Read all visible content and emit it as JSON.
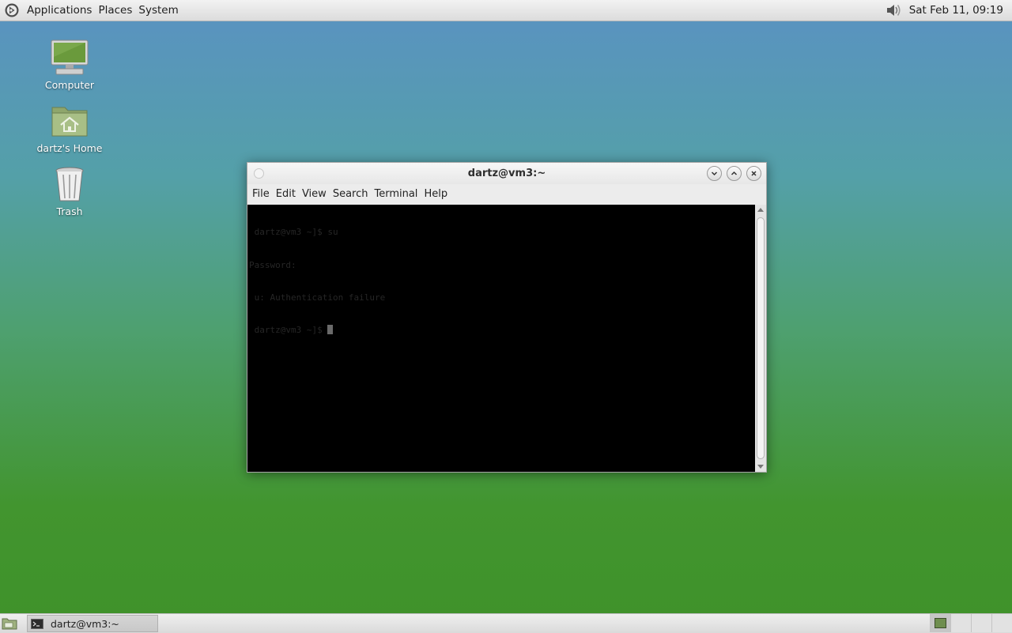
{
  "top_panel": {
    "menus": [
      "Applications",
      "Places",
      "System"
    ],
    "clock": "Sat Feb 11, 09:19",
    "icons": {
      "logo": "distro-logo-icon",
      "volume": "volume-icon"
    }
  },
  "desktop_icons": [
    {
      "label": "Computer",
      "icon": "computer-icon"
    },
    {
      "label": "dartz's Home",
      "icon": "home-folder-icon"
    },
    {
      "label": "Trash",
      "icon": "trash-icon"
    }
  ],
  "terminal_window": {
    "title": "dartz@vm3:~",
    "menu": [
      "File",
      "Edit",
      "View",
      "Search",
      "Terminal",
      "Help"
    ],
    "lines": [
      " dartz@vm3 ~]$ su",
      "Password:",
      " u: Authentication failure",
      " dartz@vm3 ~]$ "
    ],
    "colors": {
      "background": "#000000",
      "text": "#262626"
    }
  },
  "bottom_panel": {
    "task": "dartz@vm3:~",
    "workspaces": 4,
    "active_workspace": 1,
    "icons": {
      "show_desktop": "show-desktop-icon",
      "task": "terminal-icon"
    }
  }
}
